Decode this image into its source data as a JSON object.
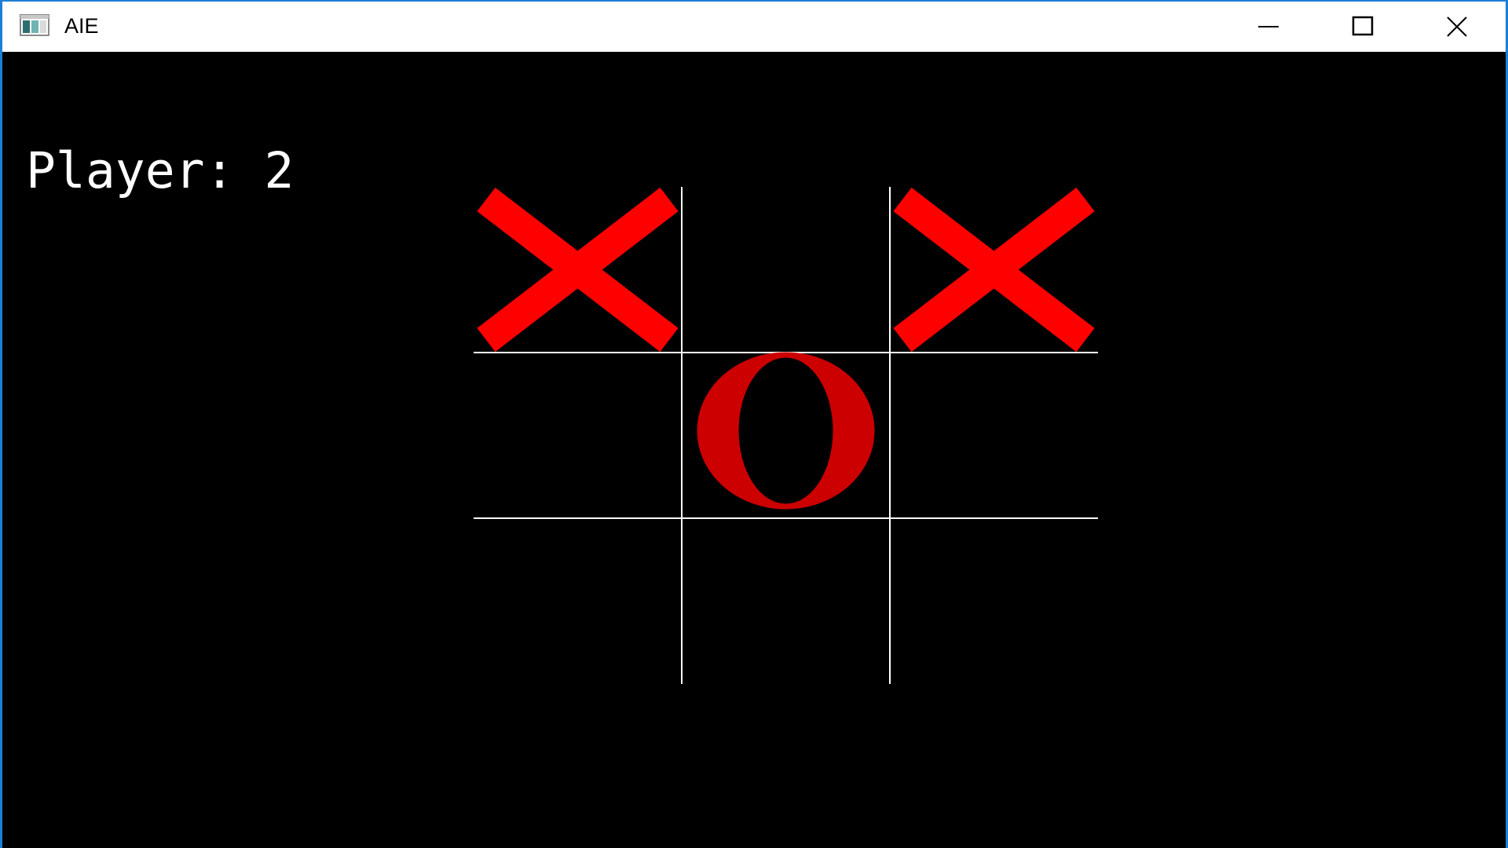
{
  "window": {
    "title": "AIE",
    "icon": "app-window-icon",
    "controls": [
      "minimize-icon",
      "maximize-icon",
      "close-icon"
    ]
  },
  "game": {
    "player_label": "Player: 2",
    "board": [
      [
        "X",
        "",
        "X"
      ],
      [
        "",
        "O",
        ""
      ],
      [
        "",
        "",
        ""
      ]
    ],
    "colors": {
      "background": "#000000",
      "grid": "#ffffff",
      "x_mark": "#ff0000",
      "o_mark": "#cc0000",
      "text": "#ffffff",
      "window_border": "#1c7fd6"
    }
  }
}
